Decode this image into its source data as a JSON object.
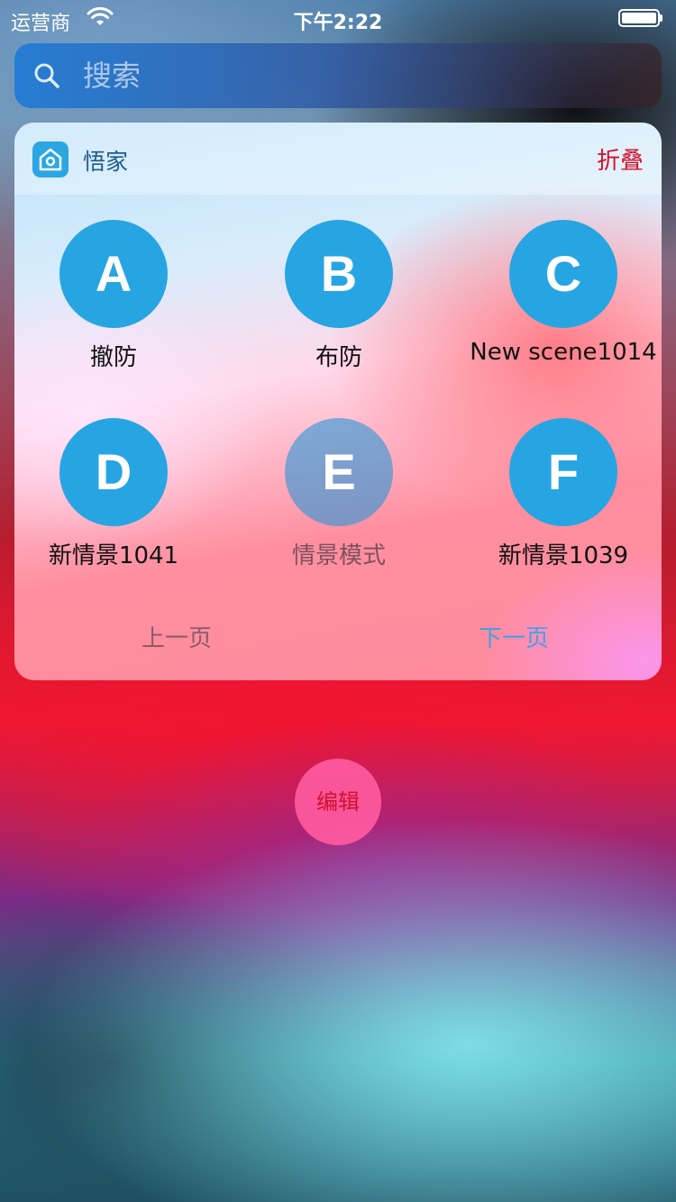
{
  "status_bar": {
    "carrier": "运营商",
    "time": "下午2:22"
  },
  "search": {
    "placeholder": "搜索"
  },
  "widget": {
    "app_name": "悟家",
    "collapse_label": "折叠",
    "scenes": [
      {
        "letter": "A",
        "label": "撤防"
      },
      {
        "letter": "B",
        "label": "布防"
      },
      {
        "letter": "C",
        "label": "New scene1014"
      },
      {
        "letter": "D",
        "label": "新情景1041"
      },
      {
        "letter": "E",
        "label": "情景模式"
      },
      {
        "letter": "F",
        "label": "新情景1039"
      }
    ],
    "prev_page_label": "上一页",
    "next_page_label": "下一页",
    "accent_color": "#27a5e2"
  },
  "edit_label": "编辑"
}
